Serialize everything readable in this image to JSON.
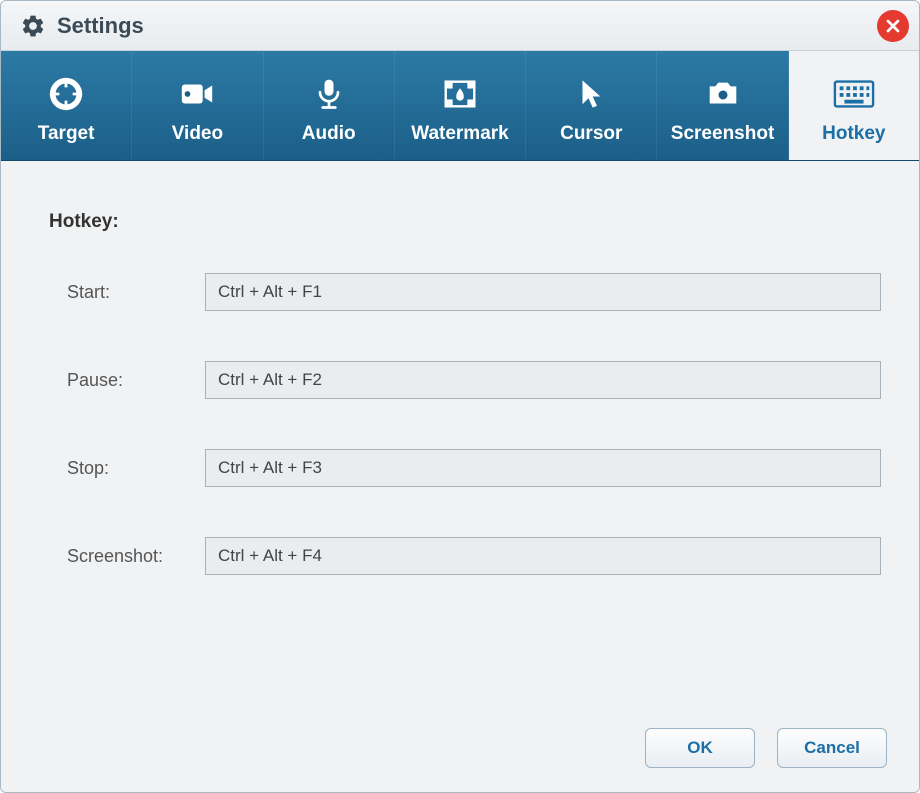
{
  "window": {
    "title": "Settings"
  },
  "tabs": {
    "target": "Target",
    "video": "Video",
    "audio": "Audio",
    "watermark": "Watermark",
    "cursor": "Cursor",
    "screenshot": "Screenshot",
    "hotkey": "Hotkey"
  },
  "section": {
    "heading": "Hotkey:"
  },
  "fields": {
    "start": {
      "label": "Start:",
      "value": "Ctrl + Alt + F1"
    },
    "pause": {
      "label": "Pause:",
      "value": "Ctrl + Alt + F2"
    },
    "stop": {
      "label": "Stop:",
      "value": "Ctrl + Alt + F3"
    },
    "screenshot": {
      "label": "Screenshot:",
      "value": "Ctrl + Alt + F4"
    }
  },
  "buttons": {
    "ok": "OK",
    "cancel": "Cancel"
  }
}
